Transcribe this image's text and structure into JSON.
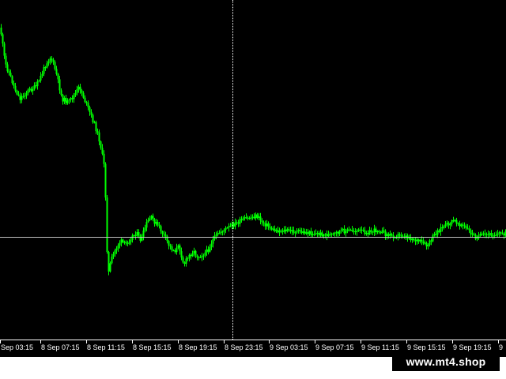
{
  "chart": {
    "background_color": "#000000",
    "candle_color": "#00ff00",
    "price_line_color": "#c0c0c0",
    "crosshair_color": "#ffffff",
    "axis_color": "#ffffff",
    "time_labels": [
      "Sep 03:15",
      "8 Sep 07:15",
      "8 Sep 11:15",
      "8 Sep 15:15",
      "8 Sep 19:15",
      "8 Sep 23:15",
      "9 Sep 03:15",
      "9 Sep 07:15",
      "9 Sep 11:15",
      "9 Sep 15:15",
      "9 Sep 19:15",
      "9"
    ]
  },
  "watermark": {
    "text": "www.mt4.shop"
  }
}
